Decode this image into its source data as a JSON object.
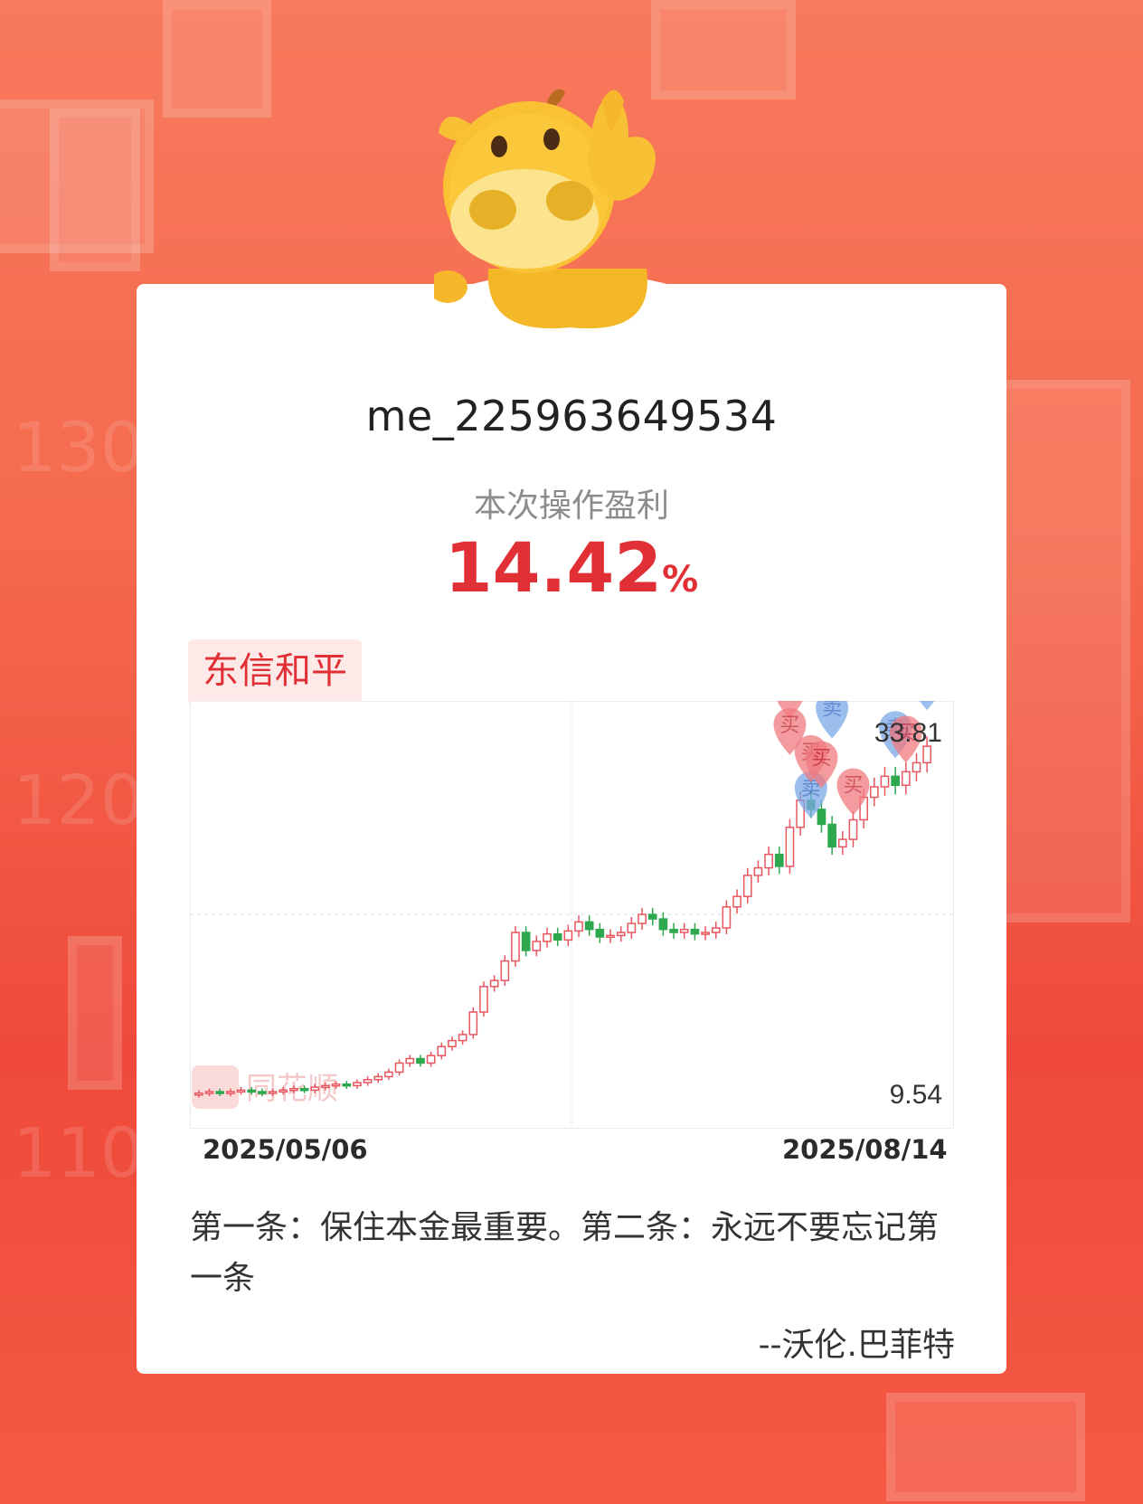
{
  "card": {
    "username": "me_225963649534",
    "subtitle": "本次操作盈利",
    "profit_value": "14.42",
    "profit_unit": "%",
    "stock_name": "东信和平",
    "watermark": "同花顺"
  },
  "colors": {
    "up": "#e8565f",
    "down": "#2ea84f",
    "sell_marker": "#7aa9e6",
    "buy_marker": "#f07a80",
    "accent": "#e03036"
  },
  "chart_data": {
    "type": "candlestick",
    "y_max_label": "33.81",
    "y_min_label": "9.54",
    "ylim": [
      9.54,
      33.81
    ],
    "x_start_label": "2025/05/06",
    "x_end_label": "2025/08/14",
    "gridlines": true,
    "closes": [
      10.1,
      10.2,
      10.1,
      10.2,
      10.3,
      10.2,
      10.1,
      10.2,
      10.3,
      10.4,
      10.3,
      10.5,
      10.6,
      10.7,
      10.6,
      10.8,
      11.0,
      11.2,
      11.5,
      12.1,
      12.4,
      12.1,
      12.6,
      13.2,
      13.6,
      14.0,
      15.5,
      17.2,
      17.6,
      18.9,
      20.8,
      19.6,
      20.2,
      20.7,
      20.3,
      20.9,
      21.5,
      21.0,
      20.5,
      20.6,
      20.8,
      21.4,
      22.0,
      21.7,
      21.0,
      20.8,
      21.0,
      20.7,
      20.8,
      21.1,
      22.5,
      23.2,
      24.6,
      25.1,
      26.0,
      25.2,
      27.8,
      29.6,
      29.0,
      28.0,
      26.5,
      27.0,
      28.3,
      29.8,
      30.5,
      31.2,
      30.6,
      31.5,
      32.1,
      33.2
    ],
    "markers": [
      {
        "label": "买",
        "kind": "buy",
        "index": 56
      },
      {
        "label": "买",
        "kind": "buy",
        "index": 56
      },
      {
        "label": "卖",
        "kind": "sell",
        "index": 60
      },
      {
        "label": "卖",
        "kind": "sell",
        "index": 58
      },
      {
        "label": "买",
        "kind": "buy",
        "index": 58
      },
      {
        "label": "买",
        "kind": "buy",
        "index": 59
      },
      {
        "label": "买",
        "kind": "buy",
        "index": 62
      },
      {
        "label": "卖",
        "kind": "sell",
        "index": 66
      },
      {
        "label": "买",
        "kind": "buy",
        "index": 67
      },
      {
        "label": "卖",
        "kind": "sell",
        "index": 69
      }
    ]
  },
  "quote": {
    "text": "第一条：保住本金最重要。第二条：永远不要忘记第一条",
    "author": "--沃伦.巴菲特"
  }
}
